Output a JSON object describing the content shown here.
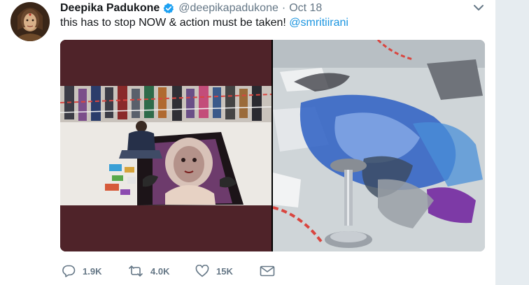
{
  "tweet": {
    "author_name": "Deepika Padukone",
    "handle": "@deepikapadukone",
    "separator": "·",
    "time": "Oct 18",
    "text": "this has to stop NOW & action must be taken! ",
    "mention": "@smritiirani",
    "verified": true
  },
  "actions": {
    "replies": "1.9K",
    "retweets": "4.0K",
    "likes": "15K"
  },
  "media": {
    "count": 2
  },
  "icons": {
    "verified": "verified-badge-icon",
    "caret": "chevron-down-icon",
    "reply": "reply-icon",
    "retweet": "retweet-icon",
    "like": "heart-icon",
    "dm": "envelope-icon"
  },
  "colors": {
    "accent": "#1b95e0",
    "muted": "#657786",
    "verified": "#1da1f2",
    "page_bg": "#e6ecf0"
  }
}
